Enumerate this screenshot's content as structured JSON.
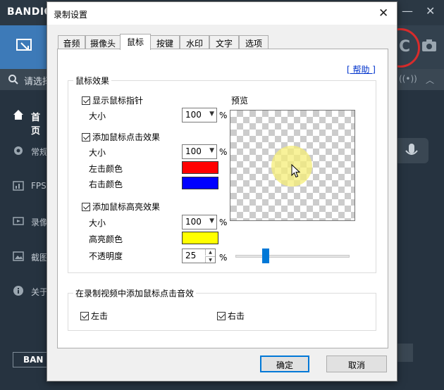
{
  "app": {
    "logo": "BANDIC",
    "search_text": "请选择",
    "rec_letter": "C",
    "sidebar": [
      {
        "label": "首页",
        "icon": "home-icon"
      },
      {
        "label": "常规",
        "icon": "gear-icon"
      },
      {
        "label": "FPS",
        "icon": "fps-icon"
      },
      {
        "label": "录像",
        "icon": "video-icon"
      },
      {
        "label": "截图",
        "icon": "image-icon"
      },
      {
        "label": "关于",
        "icon": "info-icon"
      }
    ],
    "bottom_button": "BAN",
    "accent": "#3d7ab8"
  },
  "dialog": {
    "title": "录制设置",
    "tabs": [
      "音频",
      "摄像头",
      "鼠标",
      "按键",
      "水印",
      "文字",
      "选项"
    ],
    "active_tab": "鼠标",
    "help": "[ 帮助 ]",
    "mouse_effects": {
      "group_title": "鼠标效果",
      "show_cursor": "显示鼠标指针",
      "size_label": "大小",
      "cursor_size": "100",
      "percent": "%",
      "add_click": "添加鼠标点击效果",
      "click_size_label": "大小",
      "click_size": "100",
      "left_color_label": "左击颜色",
      "left_color": "#ff0000",
      "right_color_label": "右击颜色",
      "right_color": "#0000ff",
      "add_highlight": "添加鼠标高亮效果",
      "hl_size_label": "大小",
      "hl_size": "100",
      "hl_color_label": "高亮颜色",
      "hl_color": "#ffff00",
      "opacity_label": "不透明度",
      "opacity": "25",
      "preview_label": "预览",
      "preview_zoom": 0.25
    },
    "click_sound": {
      "group_title": "在录制视频中添加鼠标点击音效",
      "left": "左击",
      "right": "右击"
    },
    "ok": "确定",
    "cancel": "取消"
  }
}
